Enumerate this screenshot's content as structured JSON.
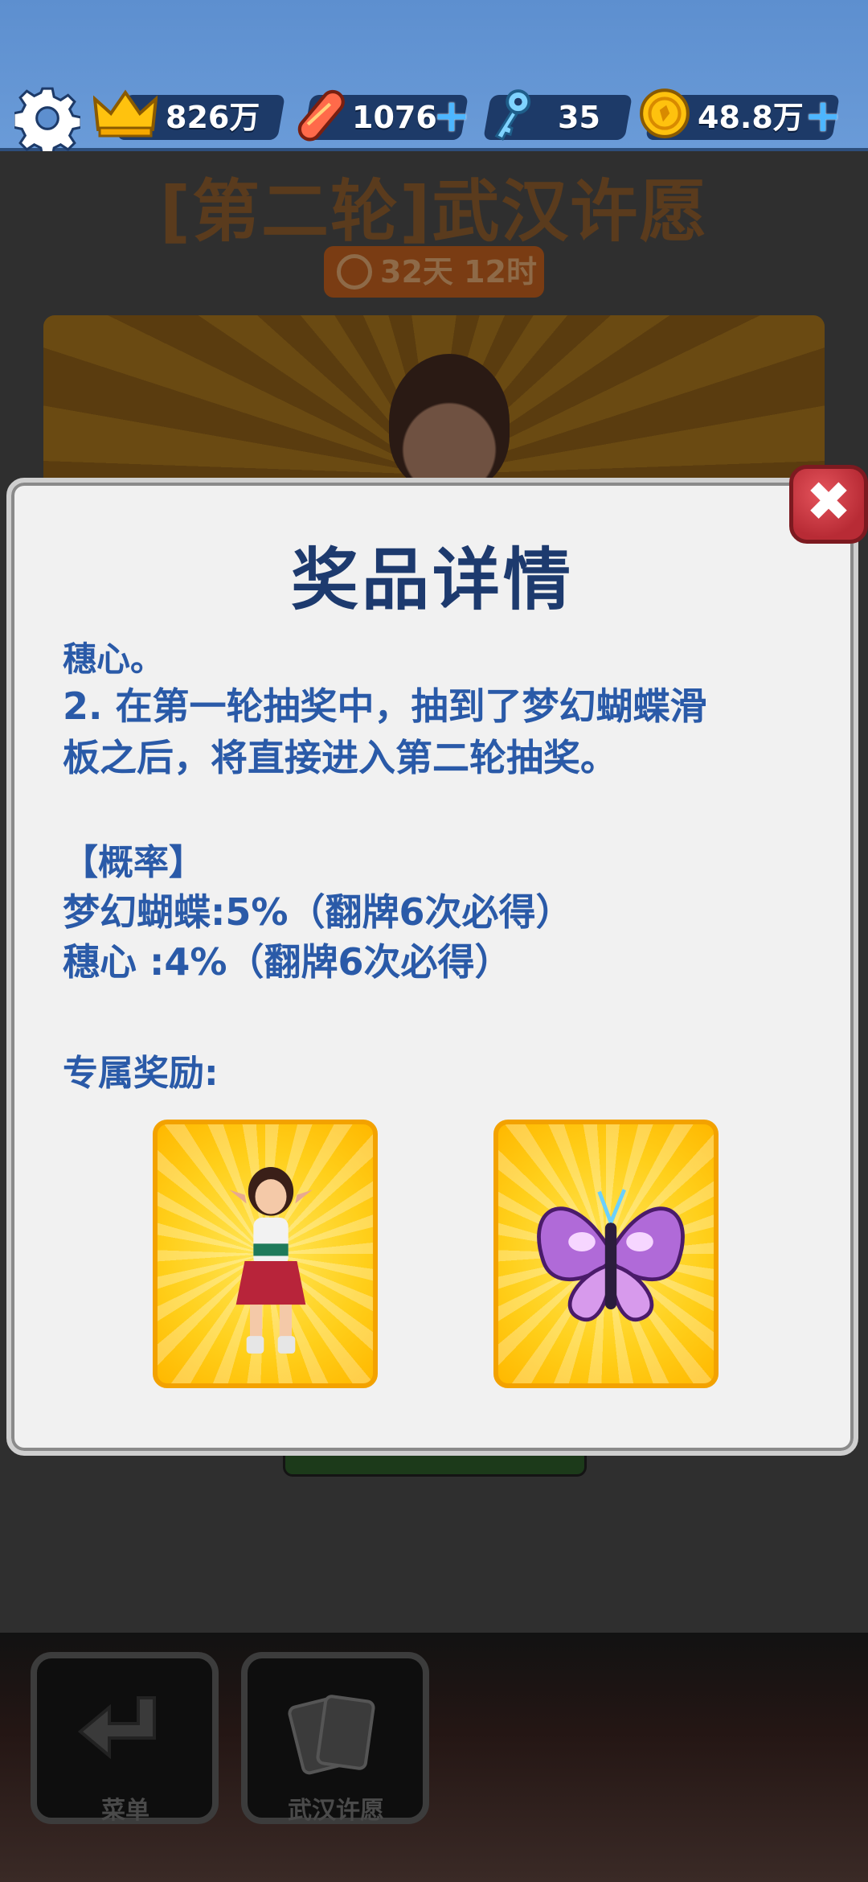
{
  "topbar": {
    "crowns": "826万",
    "hoverboards": "1076",
    "keys": "35",
    "coins": "48.8万",
    "plus": "+"
  },
  "background": {
    "title": "[第二轮]武汉许愿",
    "timer": "32天 12时"
  },
  "modal": {
    "title": "奖品详情",
    "lines": [
      "穗心。",
      "2. 在第一轮抽奖中，抽到了梦幻蝴蝶滑",
      "板之后，将直接进入第二轮抽奖。",
      "【概率】",
      "梦幻蝴蝶:5%（翻牌6次必得）",
      "穗心 :4%（翻牌6次必得）",
      "专属奖励:"
    ],
    "close": "✖"
  },
  "nav": {
    "menu_label": "菜单",
    "wish_label": "武汉许愿"
  },
  "colors": {
    "topbar": "#6a9bd8",
    "modal_text": "#2a5aa8",
    "modal_title": "#1d3a6e",
    "close_button": "#c8323c",
    "card_gold": "#ffcf1a"
  }
}
